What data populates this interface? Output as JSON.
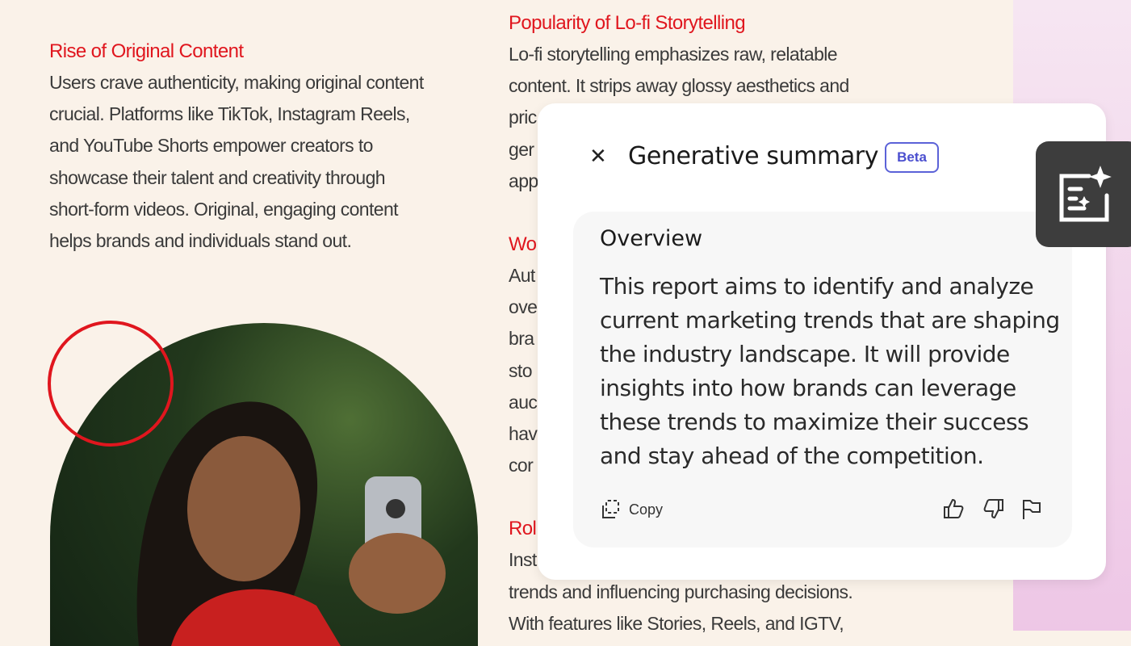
{
  "document": {
    "left": {
      "heading": "Rise of Original Content",
      "lines": [
        "Users crave authenticity, making original content",
        "crucial. Platforms like TikTok, Instagram Reels,",
        "and YouTube Shorts empower creators to",
        "showcase their talent and creativity through",
        "short-form videos. Original, engaging content",
        "helps brands and individuals stand out."
      ]
    },
    "right": {
      "heading1": "Popularity of Lo-fi Storytelling",
      "lines1": [
        "Lo-fi storytelling emphasizes raw, relatable",
        "content. It strips away glossy aesthetics and",
        "pric",
        "ger",
        "app"
      ],
      "heading2": "Wo",
      "lines2": [
        "Aut",
        "ove",
        "bra",
        "sto",
        "auc",
        "hav",
        "cor"
      ],
      "heading3": "Rol",
      "lines3": [
        "Inst",
        "trends and influencing purchasing decisions.",
        "With features like Stories, Reels, and IGTV,"
      ]
    }
  },
  "panel": {
    "close_icon": "close-icon",
    "title": "Generative summary",
    "badge": "Beta",
    "card": {
      "heading": "Overview",
      "text": "This report aims to identify and analyze current marketing trends that are shaping the industry landscape. It will provide insights into how brands can leverage these trends to maximize their success and stay ahead of the competition.",
      "copy_label": "Copy"
    }
  },
  "side_tab": {
    "icon": "generative-summary-icon"
  },
  "colors": {
    "accent_red": "#e0161e",
    "badge_blue": "#4b4fcf",
    "tab_dark": "#3d3d3d"
  }
}
